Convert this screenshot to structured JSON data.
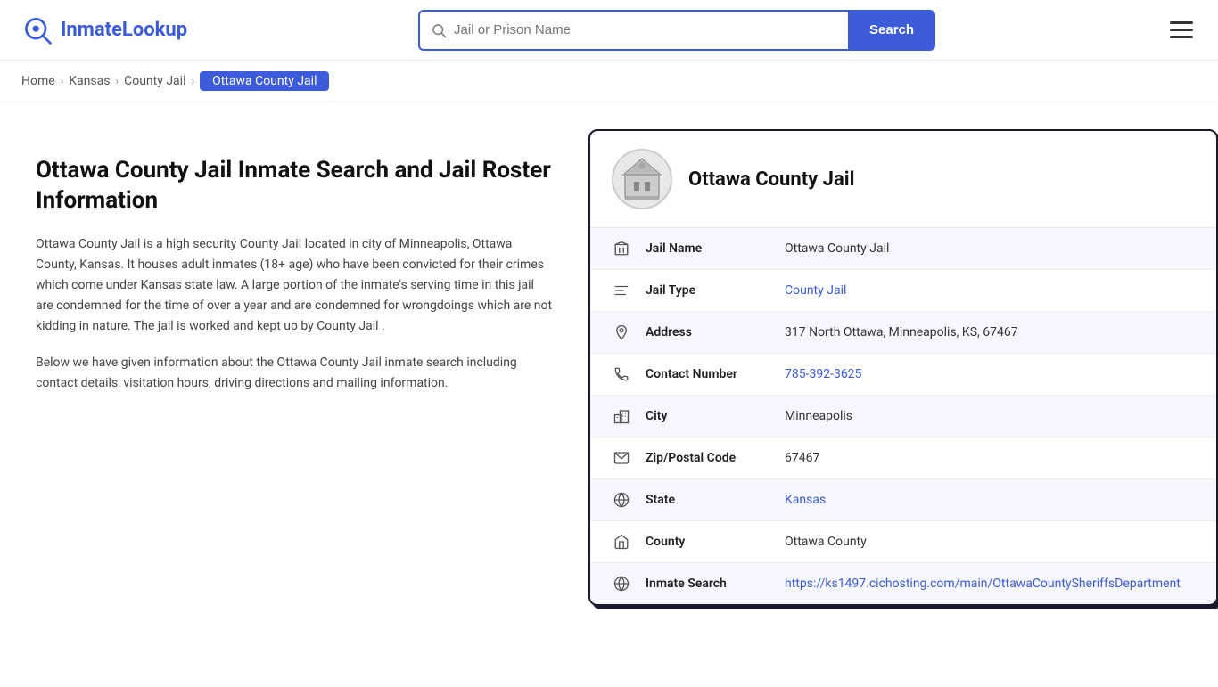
{
  "header": {
    "logo_text_part1": "Inmate",
    "logo_text_part2": "Lookup",
    "search_placeholder": "Jail or Prison Name",
    "search_button_label": "Search"
  },
  "breadcrumb": {
    "items": [
      {
        "label": "Home",
        "href": "#"
      },
      {
        "label": "Kansas",
        "href": "#"
      },
      {
        "label": "County Jail",
        "href": "#"
      },
      {
        "label": "Ottawa County Jail",
        "current": true
      }
    ]
  },
  "left": {
    "title": "Ottawa County Jail Inmate Search and Jail Roster Information",
    "desc1": "Ottawa County Jail is a high security County Jail located in city of Minneapolis, Ottawa County, Kansas. It houses adult inmates (18+ age) who have been convicted for their crimes which come under Kansas state law. A large portion of the inmate's serving time in this jail are condemned for the time of over a year and are condemned for wrongdoings which are not kidding in nature. The jail is worked and kept up by County Jail .",
    "desc2": "Below we have given information about the Ottawa County Jail inmate search including contact details, visitation hours, driving directions and mailing information."
  },
  "card": {
    "name": "Ottawa County Jail",
    "rows": [
      {
        "icon": "jail-icon",
        "label": "Jail Name",
        "value": "Ottawa County Jail",
        "link": null
      },
      {
        "icon": "type-icon",
        "label": "Jail Type",
        "value": "County Jail",
        "link": "#"
      },
      {
        "icon": "address-icon",
        "label": "Address",
        "value": "317 North Ottawa, Minneapolis, KS, 67467",
        "link": null
      },
      {
        "icon": "phone-icon",
        "label": "Contact Number",
        "value": "785-392-3625",
        "link": "tel:785-392-3625"
      },
      {
        "icon": "city-icon",
        "label": "City",
        "value": "Minneapolis",
        "link": null
      },
      {
        "icon": "zip-icon",
        "label": "Zip/Postal Code",
        "value": "67467",
        "link": null
      },
      {
        "icon": "state-icon",
        "label": "State",
        "value": "Kansas",
        "link": "#"
      },
      {
        "icon": "county-icon",
        "label": "County",
        "value": "Ottawa County",
        "link": null
      },
      {
        "icon": "inmate-icon",
        "label": "Inmate Search",
        "value": "https://ks1497.cichosting.com/main/OttawaCountySheriffsDepartment",
        "link": "https://ks1497.cichosting.com/main/OttawaCountySheriffsDepartment"
      }
    ]
  }
}
